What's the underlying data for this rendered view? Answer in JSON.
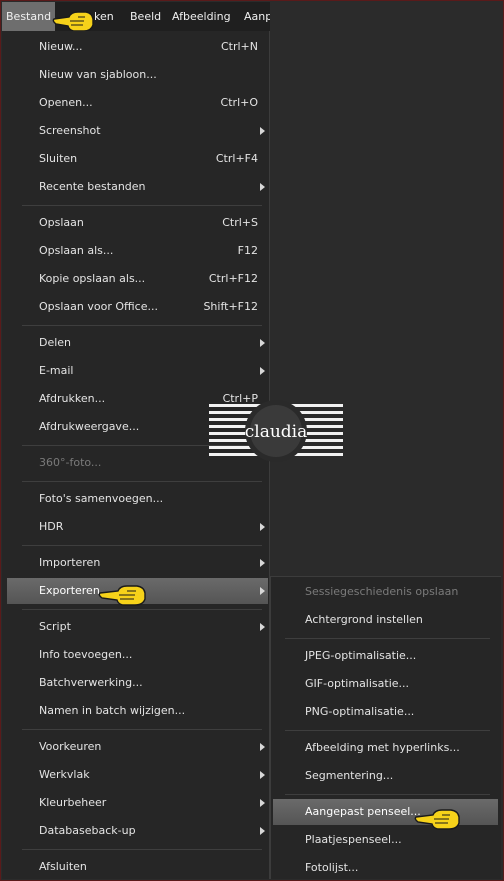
{
  "menubar": {
    "items": [
      {
        "label": "Bestand"
      },
      {
        "label": "ken"
      },
      {
        "label": "Beeld"
      },
      {
        "label": "Afbeelding"
      },
      {
        "label": "Aanp"
      }
    ]
  },
  "file_menu": {
    "items": [
      {
        "label": "Nieuw...",
        "shortcut": "Ctrl+N"
      },
      {
        "label": "Nieuw van sjabloon...",
        "shortcut": ""
      },
      {
        "label": "Openen...",
        "shortcut": "Ctrl+O"
      },
      {
        "label": "Screenshot",
        "shortcut": ""
      },
      {
        "label": "Sluiten",
        "shortcut": "Ctrl+F4"
      },
      {
        "label": "Recente bestanden",
        "shortcut": ""
      },
      {
        "label": "Opslaan",
        "shortcut": "Ctrl+S"
      },
      {
        "label": "Opslaan als...",
        "shortcut": "F12"
      },
      {
        "label": "Kopie opslaan als...",
        "shortcut": "Ctrl+F12"
      },
      {
        "label": "Opslaan voor Office...",
        "shortcut": "Shift+F12"
      },
      {
        "label": "Delen",
        "shortcut": ""
      },
      {
        "label": "E-mail",
        "shortcut": ""
      },
      {
        "label": "Afdrukken...",
        "shortcut": "Ctrl+P"
      },
      {
        "label": "Afdrukweergave...",
        "shortcut": ""
      },
      {
        "label": "360°-foto...",
        "shortcut": ""
      },
      {
        "label": "Foto's samenvoegen...",
        "shortcut": ""
      },
      {
        "label": "HDR",
        "shortcut": ""
      },
      {
        "label": "Importeren",
        "shortcut": ""
      },
      {
        "label": "Exporteren",
        "shortcut": ""
      },
      {
        "label": "Script",
        "shortcut": ""
      },
      {
        "label": "Info toevoegen...",
        "shortcut": ""
      },
      {
        "label": "Batchverwerking...",
        "shortcut": ""
      },
      {
        "label": "Namen in batch wijzigen...",
        "shortcut": ""
      },
      {
        "label": "Voorkeuren",
        "shortcut": ""
      },
      {
        "label": "Werkvlak",
        "shortcut": ""
      },
      {
        "label": "Kleurbeheer",
        "shortcut": ""
      },
      {
        "label": "Databaseback-up",
        "shortcut": ""
      },
      {
        "label": "Afsluiten",
        "shortcut": ""
      }
    ]
  },
  "export_submenu": {
    "items": [
      {
        "label": "Sessiegeschiedenis opslaan"
      },
      {
        "label": "Achtergrond instellen"
      },
      {
        "label": "JPEG-optimalisatie..."
      },
      {
        "label": "GIF-optimalisatie..."
      },
      {
        "label": "PNG-optimalisatie..."
      },
      {
        "label": "Afbeelding met hyperlinks..."
      },
      {
        "label": "Segmentering..."
      },
      {
        "label": "Aangepast penseel..."
      },
      {
        "label": "Plaatjespenseel..."
      },
      {
        "label": "Fotolijst..."
      }
    ]
  },
  "watermark": {
    "text": "claudia"
  },
  "icons": [
    "pointing-hand-icon",
    "submenu-arrow-icon"
  ]
}
